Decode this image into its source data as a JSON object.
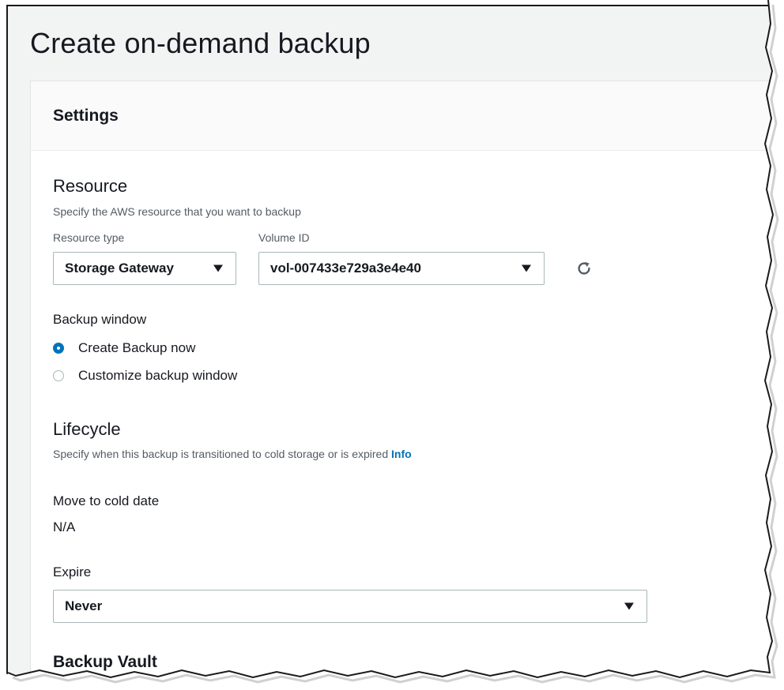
{
  "page": {
    "title": "Create on-demand backup"
  },
  "settings": {
    "heading": "Settings",
    "resource": {
      "title": "Resource",
      "description": "Specify the AWS resource that you want to backup",
      "resource_type_label": "Resource type",
      "resource_type_value": "Storage Gateway",
      "volume_id_label": "Volume ID",
      "volume_id_value": "vol-007433e729a3e4e40"
    },
    "backup_window": {
      "label": "Backup window",
      "options": [
        {
          "label": "Create Backup now",
          "selected": true
        },
        {
          "label": "Customize backup window",
          "selected": false
        }
      ]
    },
    "lifecycle": {
      "title": "Lifecycle",
      "description": "Specify when this backup is transitioned to cold storage or is expired",
      "info_link": "Info",
      "move_to_cold_label": "Move to cold date",
      "move_to_cold_value": "N/A",
      "expire_label": "Expire",
      "expire_value": "Never"
    },
    "backup_vault": {
      "title": "Backup Vault"
    }
  },
  "colors": {
    "accent": "#0073bb",
    "border": "#aab7b8",
    "page_bg": "#f2f3f3"
  },
  "icons": {
    "refresh": "refresh-icon",
    "caret": "caret-down-icon"
  }
}
